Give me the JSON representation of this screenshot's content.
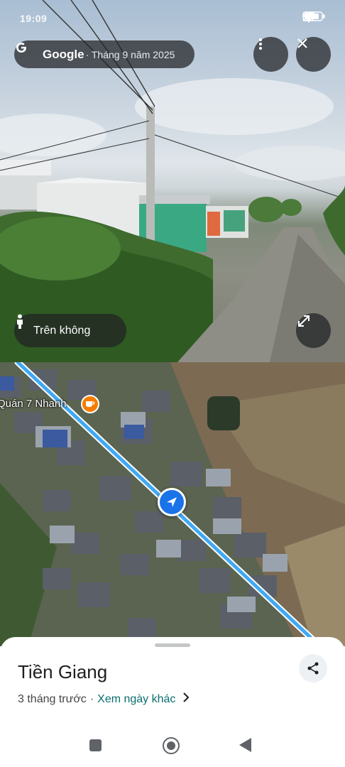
{
  "status_bar": {
    "time": "19:09",
    "icons": [
      "location-arrow-icon",
      "signal-icon",
      "signal-icon",
      "wifi-icon",
      "battery-icon"
    ]
  },
  "street_view": {
    "brand": "Google",
    "date": "· Tháng 9 năm 2025",
    "aerial_label": "Trên không",
    "icons": {
      "more": "more-vertical-icon",
      "close": "close-icon",
      "expand": "expand-icon",
      "person": "person-icon"
    }
  },
  "map": {
    "poi_name": "Quán 7 Nhanh",
    "poi_icon": "cafe-icon",
    "route_color": "#3fa9f5",
    "marker_color": "#1a73e8"
  },
  "place": {
    "title": "Tiền Giang",
    "time_ago": "3 tháng trước",
    "separator": "·",
    "other_dates_link": "Xem ngày khác"
  },
  "nav_bar": {
    "icons": [
      "recents-icon",
      "home-icon",
      "back-icon"
    ]
  }
}
